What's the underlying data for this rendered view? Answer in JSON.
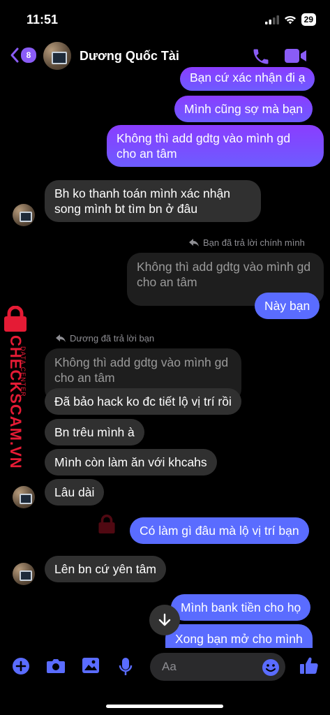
{
  "status": {
    "time": "11:51",
    "battery": "29",
    "signal_icon": "signal-icon",
    "wifi_icon": "wifi-icon"
  },
  "header": {
    "back_count": "8",
    "contact_name": "Dương Quốc Tài",
    "call_icon": "phone-icon",
    "video_icon": "video-call-icon"
  },
  "messages": {
    "m1": "Bạn cứ xác nhận đi ạ",
    "m2": "Mình cũng sợ mà bạn",
    "m3_l1": "Không thì add gdtg vào mình gd",
    "m3_l2": "cho an tâm",
    "m4_l1": "Bh ko thanh toán mình xác nhận",
    "m4_l2": "song mình bt tìm bn ở đâu",
    "reply_note_1": "Bạn đã trả lời chính mình",
    "quote1_l1": "Không thì add gdtg vào mình gd",
    "quote1_l2": "cho an tâm",
    "m5": "Này bạn",
    "reply_note_2": "Dương đã trả lời bạn",
    "quote2_l1": "Không thì add gdtg vào mình gd",
    "quote2_l2": "cho an tâm",
    "m6": "Đã bảo hack ko đc tiết lộ vị trí rồi",
    "m7": "Bn trêu mình à",
    "m8": "Mình còn làm ăn với khcahs",
    "m9": "Lâu dài",
    "m10": "Có làm gì đâu mà lộ vị trí bạn",
    "m11": "Lên bn cứ yên tâm",
    "m12": "Mình bank tiền cho họ",
    "m13": "Xong bạn mở cho mình"
  },
  "watermark": {
    "brand": "CHECKSCAM.VN",
    "sub": "DATA CENTER"
  },
  "composer": {
    "placeholder": "Aa"
  },
  "colors": {
    "accent": "#8a5cf6",
    "incoming": "#303030",
    "outgoing_blue": "#5a6cff",
    "watermark": "#e51b35"
  }
}
